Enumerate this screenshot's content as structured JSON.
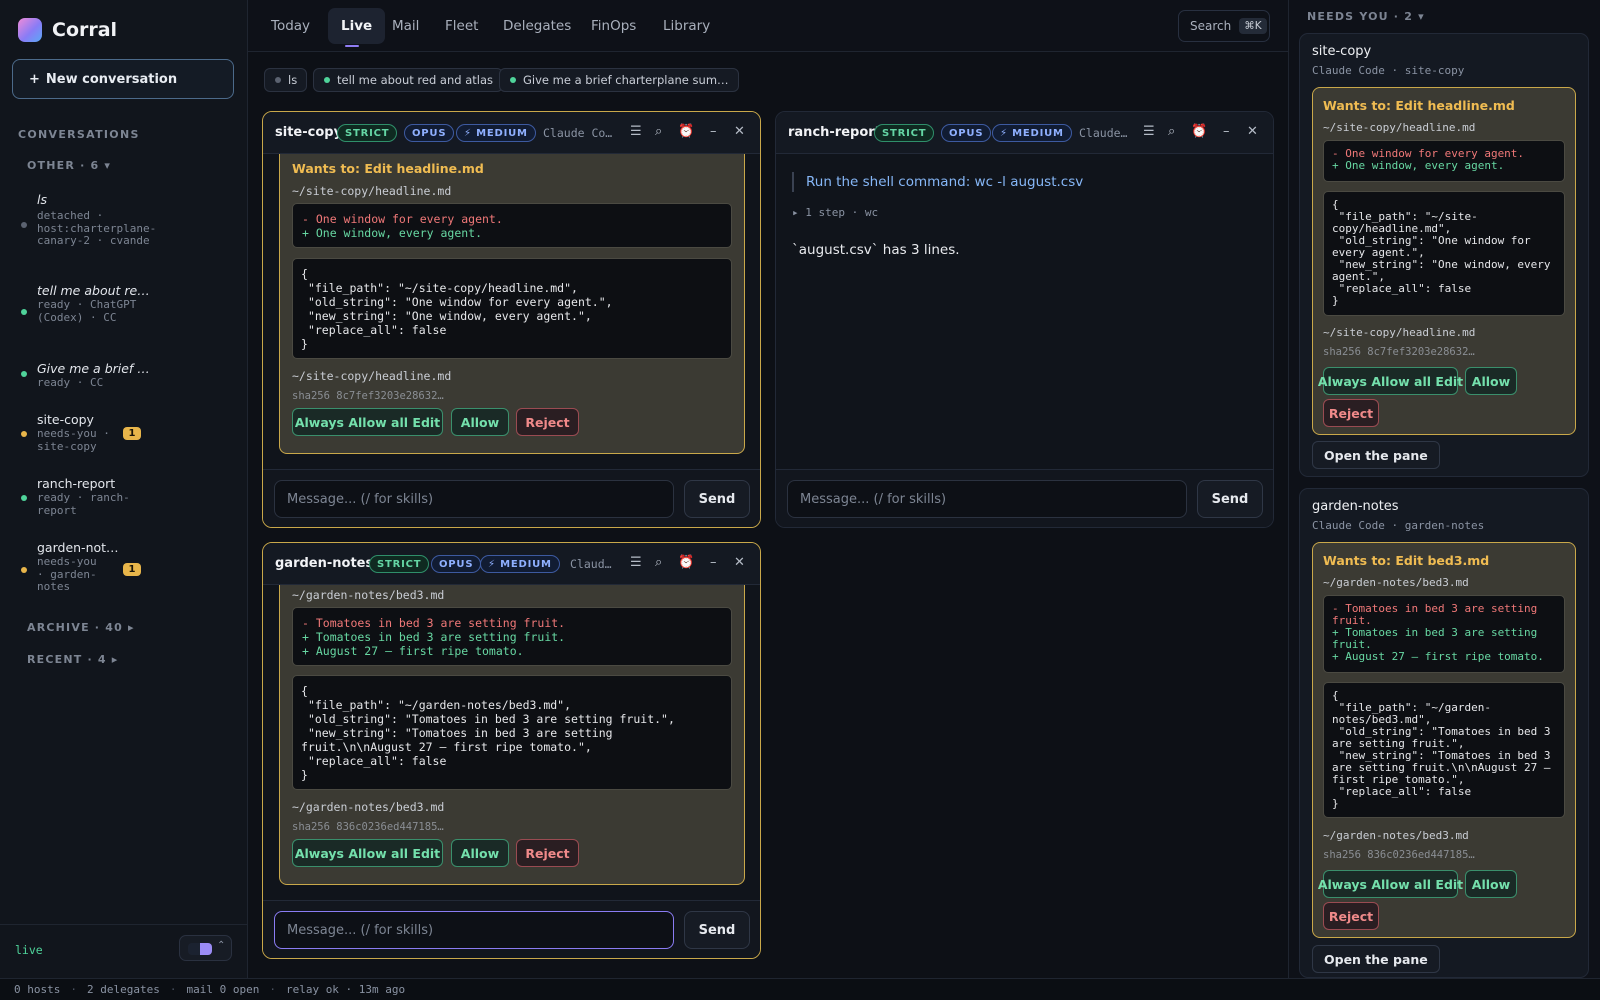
{
  "app": {
    "name": "Corral"
  },
  "sidebar": {
    "new_conversation": "New conversation",
    "plus": "+",
    "section_label": "CONVERSATIONS",
    "group_other": "OTHER · 6 ▾",
    "group_archive": "ARCHIVE · 40 ▸",
    "group_recent": "RECENT · 4 ▸",
    "items": [
      {
        "title": "ls",
        "sub": "detached · host:charterplane-canary-2 · cvande",
        "status_color": "#5b6270"
      },
      {
        "title": "tell me about re…",
        "sub": "ready · ChatGPT (Codex) · CC",
        "status_color": "#4fd39a"
      },
      {
        "title": "Give me a brief …",
        "sub": "ready · CC",
        "status_color": "#4fd39a"
      },
      {
        "title": "site-copy",
        "sub": "needs-you · site-copy",
        "status_color": "#e8b54a",
        "badge": "1"
      },
      {
        "title": "ranch-report",
        "sub": "ready · ranch-report",
        "status_color": "#4fd39a"
      },
      {
        "title": "garden-not…",
        "sub": "needs-you · garden-notes",
        "status_color": "#e8b54a",
        "badge": "1"
      }
    ],
    "footer_live": "live"
  },
  "nav": {
    "tabs": [
      "Today",
      "Live",
      "Mail",
      "Fleet",
      "Delegates",
      "FinOps",
      "Library"
    ],
    "active": "Live",
    "search_label": "Search",
    "search_kbd": "⌘K"
  },
  "chips": [
    {
      "label": "ls",
      "color": "#5b6270"
    },
    {
      "label": "tell me about red and atlas",
      "color": "#4fd39a"
    },
    {
      "label": "Give me a brief charterplane sum…",
      "color": "#4fd39a"
    }
  ],
  "tags": {
    "strict": "STRICT",
    "opus": "OPUS",
    "medium": "⚡ MEDIUM"
  },
  "icons": {
    "menu": "☰",
    "search": "⌕",
    "alarm": "⏰",
    "minimize": "–",
    "close": "✕"
  },
  "composer": {
    "placeholder": "Message...  (/ for skills)",
    "send": "Send"
  },
  "panes": {
    "site_copy": {
      "name": "site-copy",
      "source": "Claude Co…",
      "card": {
        "title": "Wants to: Edit headline.md",
        "path": "~/site-copy/headline.md",
        "diff_minus": "- One window for every agent.",
        "diff_plus": "+ One window, every agent.",
        "json": "{\n \"file_path\": \"~/site-copy/headline.md\",\n \"old_string\": \"One window for every agent.\",\n \"new_string\": \"One window, every agent.\",\n \"replace_all\": false\n}",
        "footer_path": "~/site-copy/headline.md",
        "sha": "sha256 8c7fef3203e28632…",
        "always": "Always Allow all Edit",
        "allow": "Allow",
        "reject": "Reject"
      }
    },
    "ranch_report": {
      "name": "ranch-report",
      "source": "Claude…",
      "prompt": "Run the shell command: wc -l august.csv",
      "steps": "▸ 1 step · wc",
      "answer": "`august.csv` has 3 lines."
    },
    "garden_notes": {
      "name": "garden-notes",
      "source": "Claud…",
      "card": {
        "path": "~/garden-notes/bed3.md",
        "diff_minus": "- Tomatoes in bed 3 are setting fruit.",
        "diff_plus1": "+ Tomatoes in bed 3 are setting fruit.",
        "diff_plus2": "+ August 27 — first ripe tomato.",
        "json": "{\n \"file_path\": \"~/garden-notes/bed3.md\",\n \"old_string\": \"Tomatoes in bed 3 are setting fruit.\",\n \"new_string\": \"Tomatoes in bed 3 are setting fruit.\\n\\nAugust 27 — first ripe tomato.\",\n \"replace_all\": false\n}",
        "footer_path": "~/garden-notes/bed3.md",
        "sha": "sha256 836c0236ed447185…",
        "always": "Always Allow all Edit",
        "allow": "Allow",
        "reject": "Reject"
      }
    }
  },
  "right": {
    "header": "NEEDS YOU · 2 ▾",
    "open_pane": "Open the pane",
    "cards": [
      {
        "name": "site-copy",
        "sub": "Claude Code · site-copy",
        "title": "Wants to: Edit headline.md",
        "path": "~/site-copy/headline.md",
        "diff_minus": "- One window for every agent.",
        "diff_plus": "+ One window, every agent.",
        "json": "{\n \"file_path\": \"~/site-copy/headline.md\",\n \"old_string\": \"One window for every agent.\",\n \"new_string\": \"One window, every agent.\",\n \"replace_all\": false\n}",
        "footer_path": "~/site-copy/headline.md",
        "sha": "sha256 8c7fef3203e28632…"
      },
      {
        "name": "garden-notes",
        "sub": "Claude Code · garden-notes",
        "title": "Wants to: Edit bed3.md",
        "path": "~/garden-notes/bed3.md",
        "diff_minus": "- Tomatoes in bed 3 are setting fruit.",
        "diff_plus1": "+ Tomatoes in bed 3 are setting fruit.",
        "diff_plus2": "+ August 27 — first ripe tomato.",
        "json": "{\n \"file_path\": \"~/garden-notes/bed3.md\",\n \"old_string\": \"Tomatoes in bed 3 are setting fruit.\",\n \"new_string\": \"Tomatoes in bed 3 are setting fruit.\\n\\nAugust 27 — first ripe tomato.\",\n \"replace_all\": false\n}",
        "footer_path": "~/garden-notes/bed3.md",
        "sha": "sha256 836c0236ed447185…"
      }
    ],
    "always": "Always Allow all Edit",
    "allow": "Allow",
    "reject": "Reject"
  },
  "status": {
    "hosts": "0 hosts",
    "delegates": "2 delegates",
    "mail": "mail 0 open",
    "relay": "relay ok · 13m ago"
  }
}
